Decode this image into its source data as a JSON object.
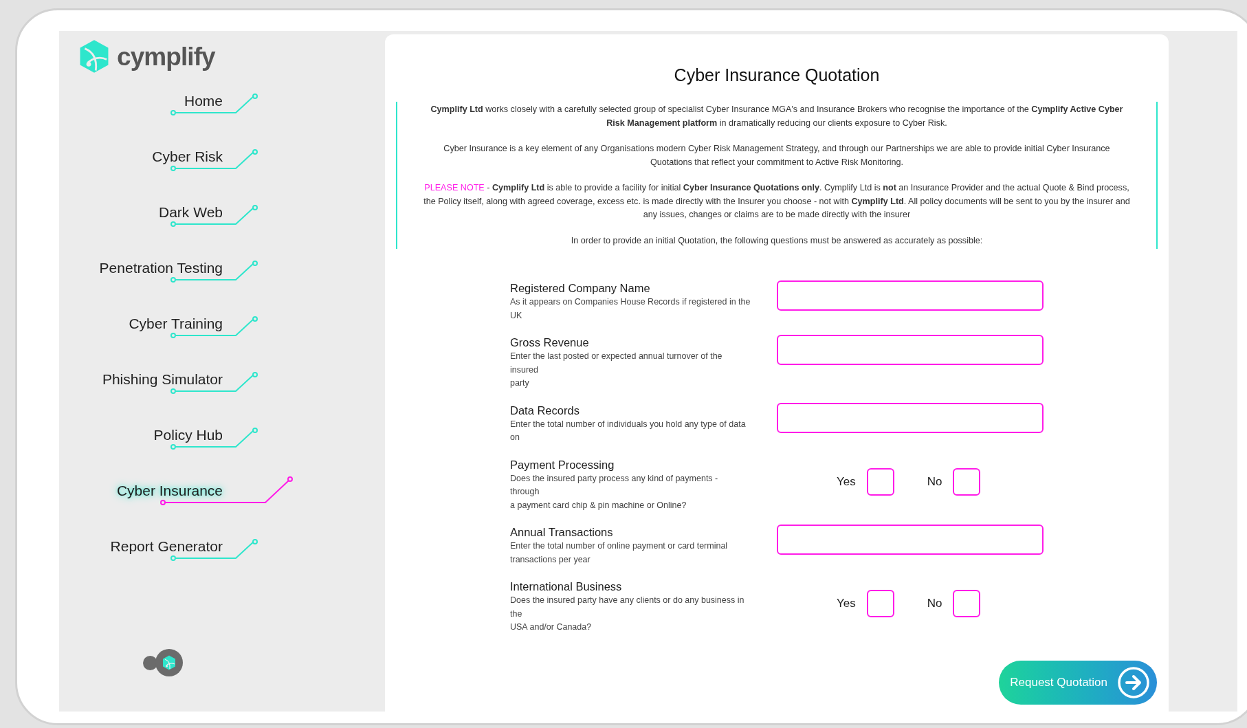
{
  "brand": {
    "name": "cymplify"
  },
  "nav": [
    {
      "label": "Home",
      "selected": false
    },
    {
      "label": "Cyber Risk",
      "selected": false
    },
    {
      "label": "Dark Web",
      "selected": false
    },
    {
      "label": "Penetration Testing",
      "selected": false
    },
    {
      "label": "Cyber Training",
      "selected": false
    },
    {
      "label": "Phishing Simulator",
      "selected": false
    },
    {
      "label": "Policy Hub",
      "selected": false
    },
    {
      "label": "Cyber Insurance",
      "selected": true
    },
    {
      "label": "Report Generator",
      "selected": false
    }
  ],
  "page": {
    "title": "Cyber Insurance Quotation",
    "intro": [
      {
        "text": "**Cymplify Ltd** works closely with a carefully selected group of specialist Cyber Insurance MGA's and Insurance Brokers who recognise the importance of the **Cymplify Active Cyber Risk Management platform** in dramatically reducing our clients exposure to Cyber Risk."
      },
      {
        "text": "Cyber Insurance is a key element of any Organisations modern Cyber Risk Management Strategy, and through our Partnerships we are able to provide initial Cyber Insurance Quotations that reflect your commitment to Active Risk Monitoring."
      },
      {
        "highlight": "PLEASE NOTE",
        "text": " - **Cymplify Ltd** is able to provide a facility for initial **Cyber Insurance Quotations** **only**. Cymplify Ltd is **not** an Insurance Provider and the actual Quote & Bind process, the Policy itself, along with agreed coverage, excess etc. is made directly with the Insurer you choose - not with **Cymplify Ltd**. All policy documents will be sent to you by the insurer and any issues, changes or claims are to be made directly with the insurer"
      },
      {
        "text": "In order to provide an initial Quotation, the following questions must be answered as accurately as possible:"
      }
    ],
    "questions": [
      {
        "kind": "text",
        "label": "Registered Company Name",
        "description": [
          "As it appears on Companies House Records if registered in the",
          "UK"
        ]
      },
      {
        "kind": "text",
        "label": "Gross Revenue",
        "description": [
          "Enter the last posted or expected annual turnover of the",
          "insured",
          "party"
        ]
      },
      {
        "kind": "text",
        "label": "Data Records",
        "description": [
          "Enter the total number of individuals you hold any type of data",
          "on"
        ]
      },
      {
        "kind": "yesno",
        "label": "Payment Processing",
        "description": [
          "Does the insured party process any kind of payments -",
          "through",
          "a payment card chip & pin machine or Online?"
        ],
        "options": [
          {
            "label": "Yes",
            "checked": false
          },
          {
            "label": "No",
            "checked": false
          }
        ]
      },
      {
        "kind": "text",
        "label": "Annual Transactions",
        "description": [
          "Enter the total number of online payment or card terminal",
          "transactions per year"
        ]
      },
      {
        "kind": "yesno",
        "label": "International Business",
        "description": [
          "Does the insured party have any clients or do any business in",
          "the",
          "USA and/or Canada?"
        ],
        "options": [
          {
            "label": "Yes",
            "checked": false
          },
          {
            "label": "No",
            "checked": false
          }
        ]
      }
    ],
    "submit": {
      "label": "Request Quotation"
    }
  }
}
